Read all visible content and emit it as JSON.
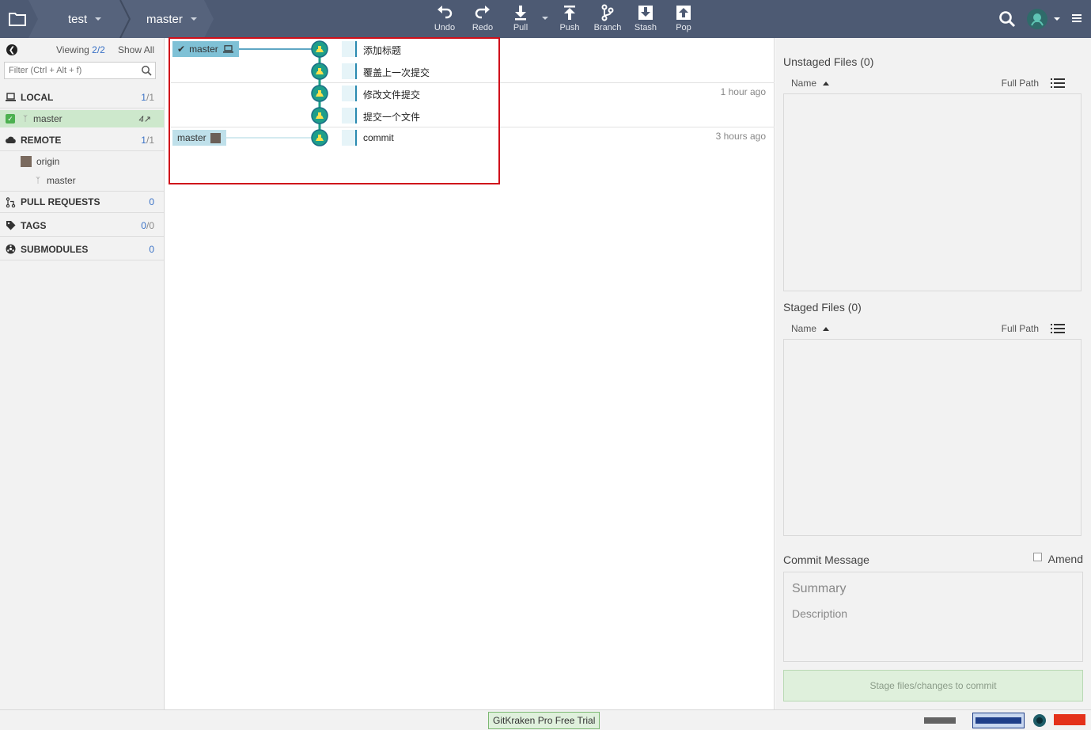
{
  "toolbar": {
    "repo": "test",
    "branch": "master",
    "actions": {
      "undo": "Undo",
      "redo": "Redo",
      "pull": "Pull",
      "push": "Push",
      "branch": "Branch",
      "stash": "Stash",
      "pop": "Pop"
    }
  },
  "left": {
    "viewing_prefix": "Viewing",
    "viewing_count": "2",
    "viewing_total": "/2",
    "show_all": "Show All",
    "filter_placeholder": "Filter (Ctrl + Alt + f)",
    "local": {
      "label": "LOCAL",
      "count": "1",
      "total": "/1"
    },
    "local_branches": [
      {
        "name": "master",
        "ahead": "4↗"
      }
    ],
    "remote": {
      "label": "REMOTE",
      "count": "1",
      "total": "/1"
    },
    "remotes": [
      {
        "name": "origin",
        "branches": [
          "master"
        ]
      }
    ],
    "pull_requests": {
      "label": "PULL REQUESTS",
      "count": "0"
    },
    "tags": {
      "label": "TAGS",
      "count": "0",
      "total": "/0"
    },
    "submodules": {
      "label": "SUBMODULES",
      "count": "0"
    }
  },
  "graph": {
    "local_ref": "master",
    "remote_ref": "master",
    "commits": [
      {
        "message": "添加标题"
      },
      {
        "message": "覆盖上一次提交"
      },
      {
        "message": "修改文件提交",
        "time": "1 hour ago"
      },
      {
        "message": "提交一个文件"
      },
      {
        "message": "commit",
        "time": "3 hours ago"
      }
    ]
  },
  "right": {
    "unstaged_title": "Unstaged Files (0)",
    "staged_title": "Staged Files (0)",
    "col_name": "Name",
    "col_full_path": "Full Path",
    "commit_message_label": "Commit Message",
    "amend_label": "Amend",
    "summary_placeholder": "Summary",
    "description_placeholder": "Description",
    "stage_button": "Stage files/changes to commit"
  },
  "status": {
    "trial": "GitKraken Pro Free Trial"
  },
  "colors": {
    "toolbar": "#4d5a73",
    "accent": "#3a72c6",
    "graph_line": "#2a8ab0",
    "commit_node": "#1e9e8a",
    "highlight": "#d0101b"
  }
}
